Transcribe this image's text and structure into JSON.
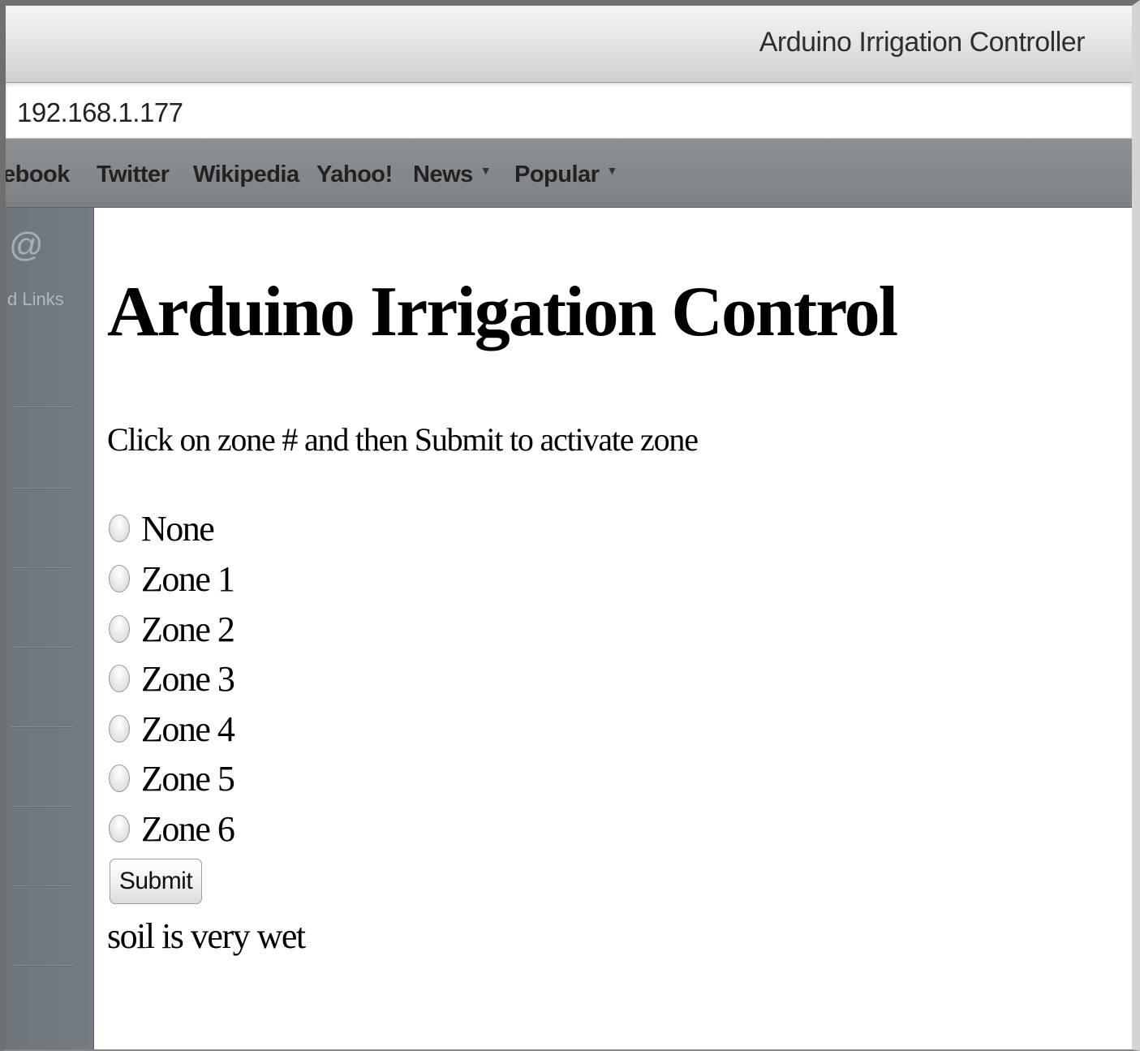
{
  "window": {
    "title": "Arduino Irrigation Controller"
  },
  "address_bar": {
    "url": "192.168.1.177"
  },
  "bookmarks": [
    {
      "label": "ebook",
      "has_menu": false
    },
    {
      "label": "Twitter",
      "has_menu": false
    },
    {
      "label": "Wikipedia",
      "has_menu": false
    },
    {
      "label": "Yahoo!",
      "has_menu": false
    },
    {
      "label": "News",
      "has_menu": true
    },
    {
      "label": "Popular",
      "has_menu": true
    }
  ],
  "sidebar": {
    "icon": "at-icon",
    "icon_glyph": "@",
    "label": "d Links"
  },
  "page": {
    "heading": "Arduino Irrigation Control",
    "instructions": "Click on zone # and then Submit to activate zone",
    "options": [
      {
        "label": "None",
        "selected": false
      },
      {
        "label": "Zone 1",
        "selected": false
      },
      {
        "label": "Zone 2",
        "selected": false
      },
      {
        "label": "Zone 3",
        "selected": false
      },
      {
        "label": "Zone 4",
        "selected": false
      },
      {
        "label": "Zone 5",
        "selected": false
      },
      {
        "label": "Zone 6",
        "selected": false
      }
    ],
    "submit_label": "Submit",
    "status": "soil is very wet"
  }
}
